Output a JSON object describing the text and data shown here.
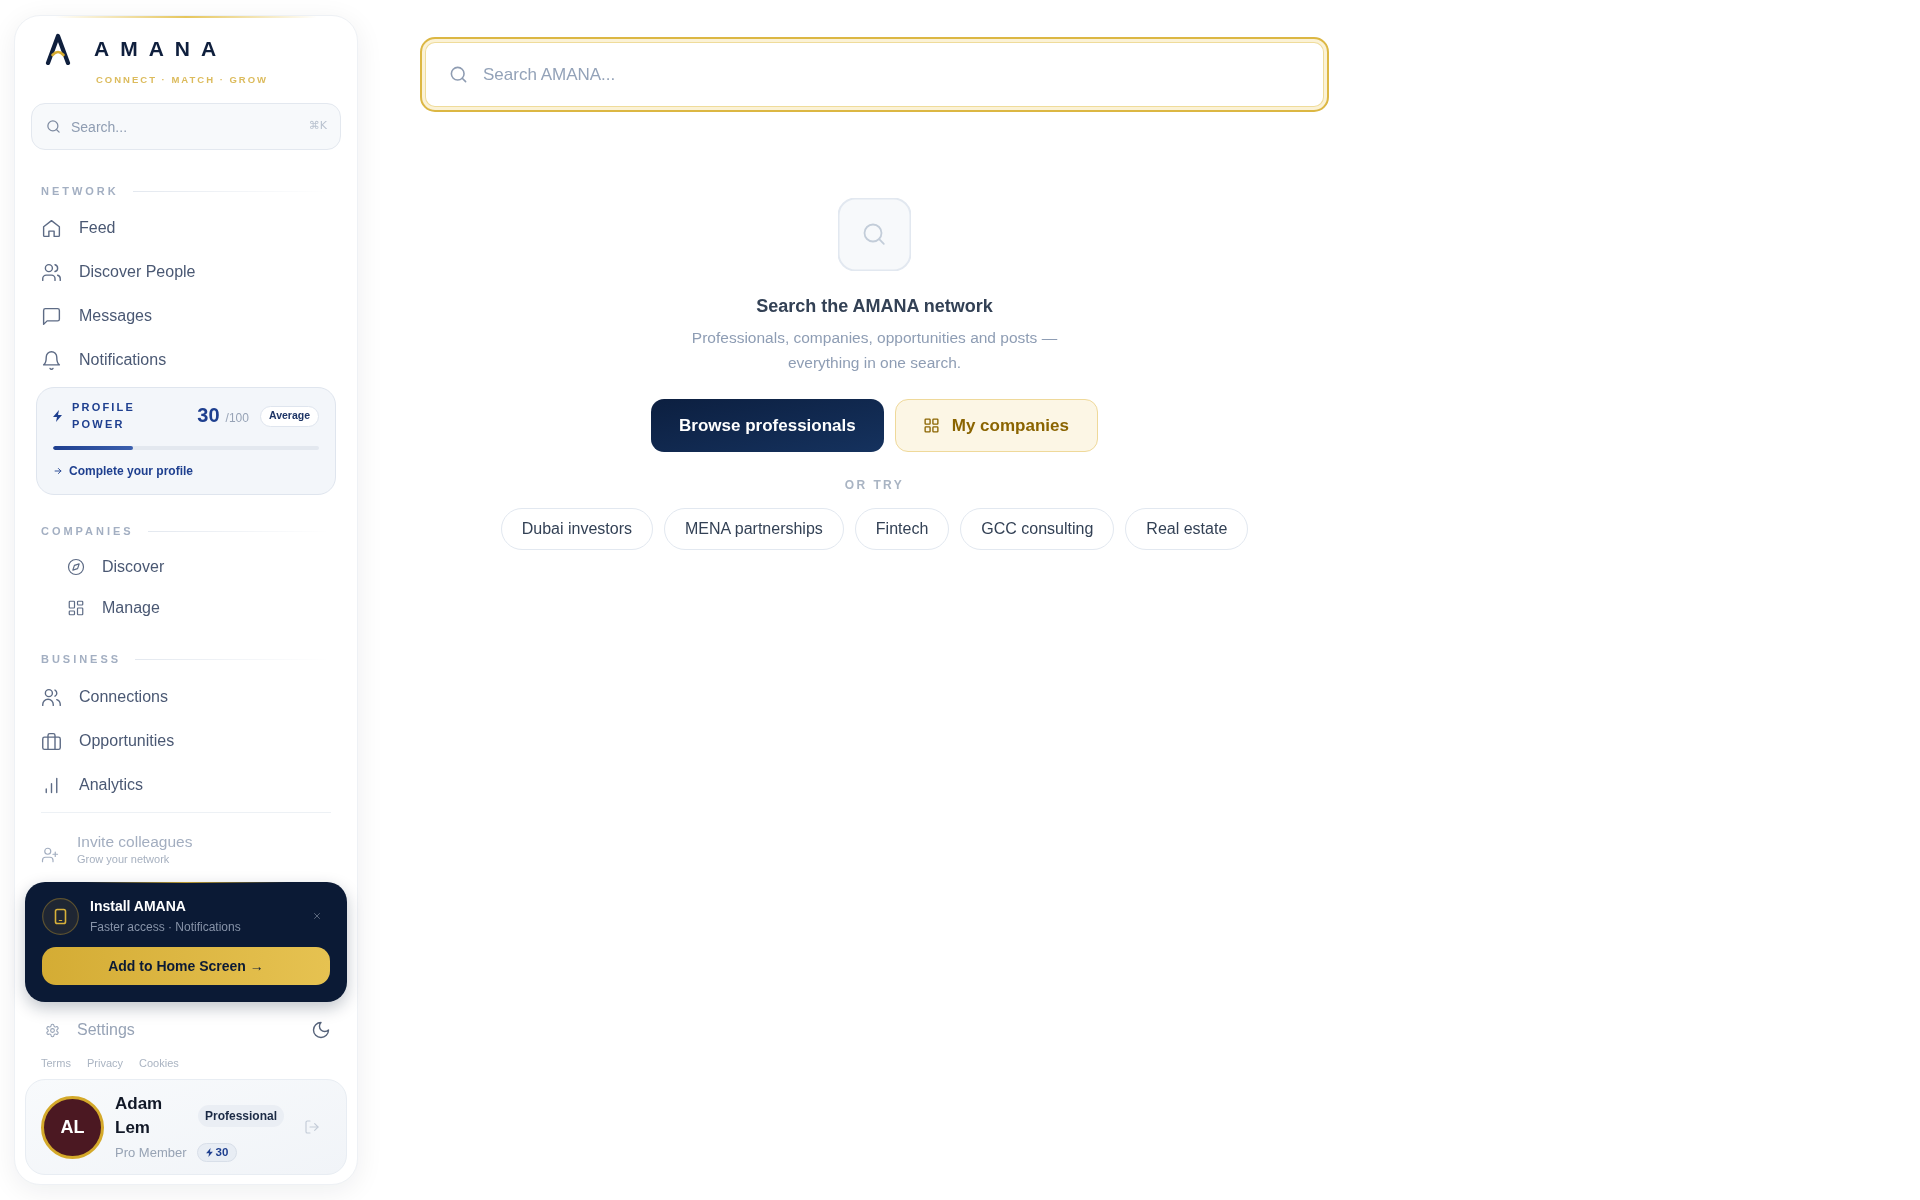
{
  "sidebar": {
    "logo": {
      "wordmark": "AMANA",
      "tagline": "CONNECT · MATCH · GROW"
    },
    "search": {
      "placeholder": "Search...",
      "shortcut": "⌘K"
    },
    "network": {
      "heading": "NETWORK",
      "items": [
        {
          "label": "Feed",
          "selected": false
        },
        {
          "label": "Discover People",
          "selected": false
        },
        {
          "label": "Messages",
          "selected": false
        },
        {
          "label": "Notifications",
          "selected": false
        }
      ]
    },
    "profile_power": {
      "title": "PROFILE POWER",
      "score": "30",
      "max": "/100",
      "rating": "Average",
      "level": 0.3,
      "link": "Complete your profile"
    },
    "companies": {
      "heading": "COMPANIES",
      "items": [
        {
          "label": "Discover",
          "selected": false
        },
        {
          "label": "Manage",
          "selected": false
        }
      ]
    },
    "business": {
      "heading": "BUSINESS",
      "items": [
        {
          "label": "Connections",
          "selected": false
        },
        {
          "label": "Opportunities",
          "selected": false
        },
        {
          "label": "Analytics",
          "selected": false
        }
      ]
    },
    "invite": {
      "label": "Invite colleagues",
      "sublabel": "Grow your network"
    },
    "install_prompt": {
      "title": "Install AMANA",
      "subtitle": "Faster access · Notifications",
      "button": "Add to Home Screen →"
    },
    "settings": {
      "label": "Settings"
    },
    "footer_links": [
      "Terms",
      "Privacy",
      "Cookies"
    ],
    "user": {
      "initials": "AL",
      "name": "Adam Lem",
      "badge": "Professional",
      "role": "Pro Member",
      "points": "30"
    }
  },
  "main": {
    "search": {
      "placeholder": "Search AMANA..."
    },
    "empty_state": {
      "title": "Search the AMANA network",
      "description": "Professionals, companies, opportunities and posts — everything in one search.",
      "actions": [
        {
          "label": "Browse professionals",
          "kind": "primary"
        },
        {
          "label": "My companies",
          "kind": "secondary"
        }
      ],
      "suggestions_heading": "OR TRY",
      "suggestions": [
        "Dubai investors",
        "MENA partnerships",
        "Fintech",
        "GCC consulting",
        "Real estate"
      ]
    }
  }
}
